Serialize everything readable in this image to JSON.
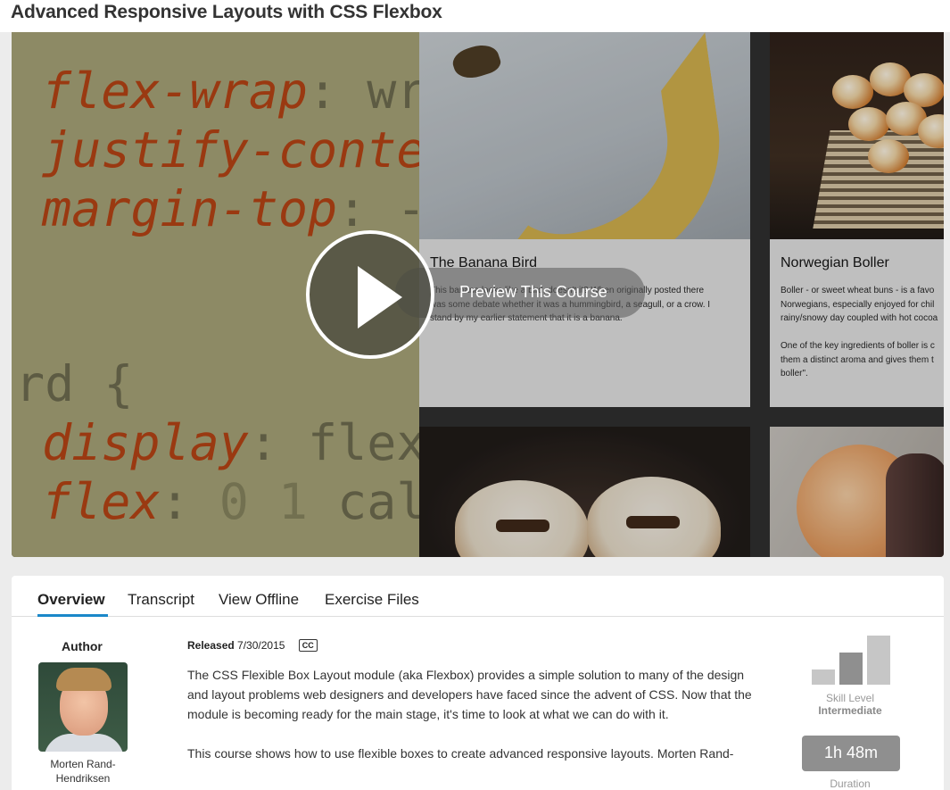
{
  "header": {
    "title": "Advanced Responsive Layouts with CSS Flexbox"
  },
  "hero": {
    "code_lines": [
      {
        "prop": "flex-wrap",
        "rest": ": wr"
      },
      {
        "prop": "justify-conte",
        "rest": ""
      },
      {
        "prop": "margin-top",
        "rest": ": -"
      },
      {
        "prop": "",
        "rest": "rd {"
      },
      {
        "prop": "display",
        "rest": ": flex"
      },
      {
        "prop": "flex",
        "rest": ": ",
        "dim": "0 1",
        "rest2": " cal"
      }
    ],
    "cards": [
      {
        "title": "The Banana Bird",
        "text": "This banana looks like a bird, doesn't it? When originally posted there\nwas some debate whether it was a hummingbird, a seagull, or a crow. I\nstand by my earlier statement that it is a banana."
      },
      {
        "title": "Norwegian Boller",
        "text": "Boller - or sweet wheat buns - is a favo\nNorwegians, especially enjoyed for chil\nrainy/snowy day coupled with hot cocoa\n\nOne of the key ingredients of boller is c\nthem a distinct aroma and gives them t\nboller\"."
      }
    ],
    "preview_label": "Preview This Course"
  },
  "tabs": [
    "Overview",
    "Transcript",
    "View Offline",
    "Exercise Files"
  ],
  "author": {
    "label": "Author",
    "name": "Morten Rand-Hendriksen"
  },
  "release": {
    "label": "Released",
    "date": "7/30/2015",
    "cc": "CC"
  },
  "description": [
    "The CSS Flexible Box Layout module (aka Flexbox) provides a simple solution to many of the design and layout problems web designers and developers have faced since the advent of CSS. Now that the module is becoming ready for the main stage, it's time to look at what we can do with it.",
    "This course shows how to use flexible boxes to create advanced responsive layouts. Morten Rand-"
  ],
  "skill": {
    "label": "Skill Level",
    "value": "Intermediate",
    "level": 2,
    "max": 3,
    "colors": {
      "bar_active": "#8f8f8f",
      "bar_inactive": "#c6c6c6"
    }
  },
  "duration": {
    "value": "1h 48m",
    "label": "Duration"
  },
  "colors": {
    "accent": "#1a88c9",
    "code_prop": "#b6400f",
    "code_panel": "#a6a376"
  }
}
